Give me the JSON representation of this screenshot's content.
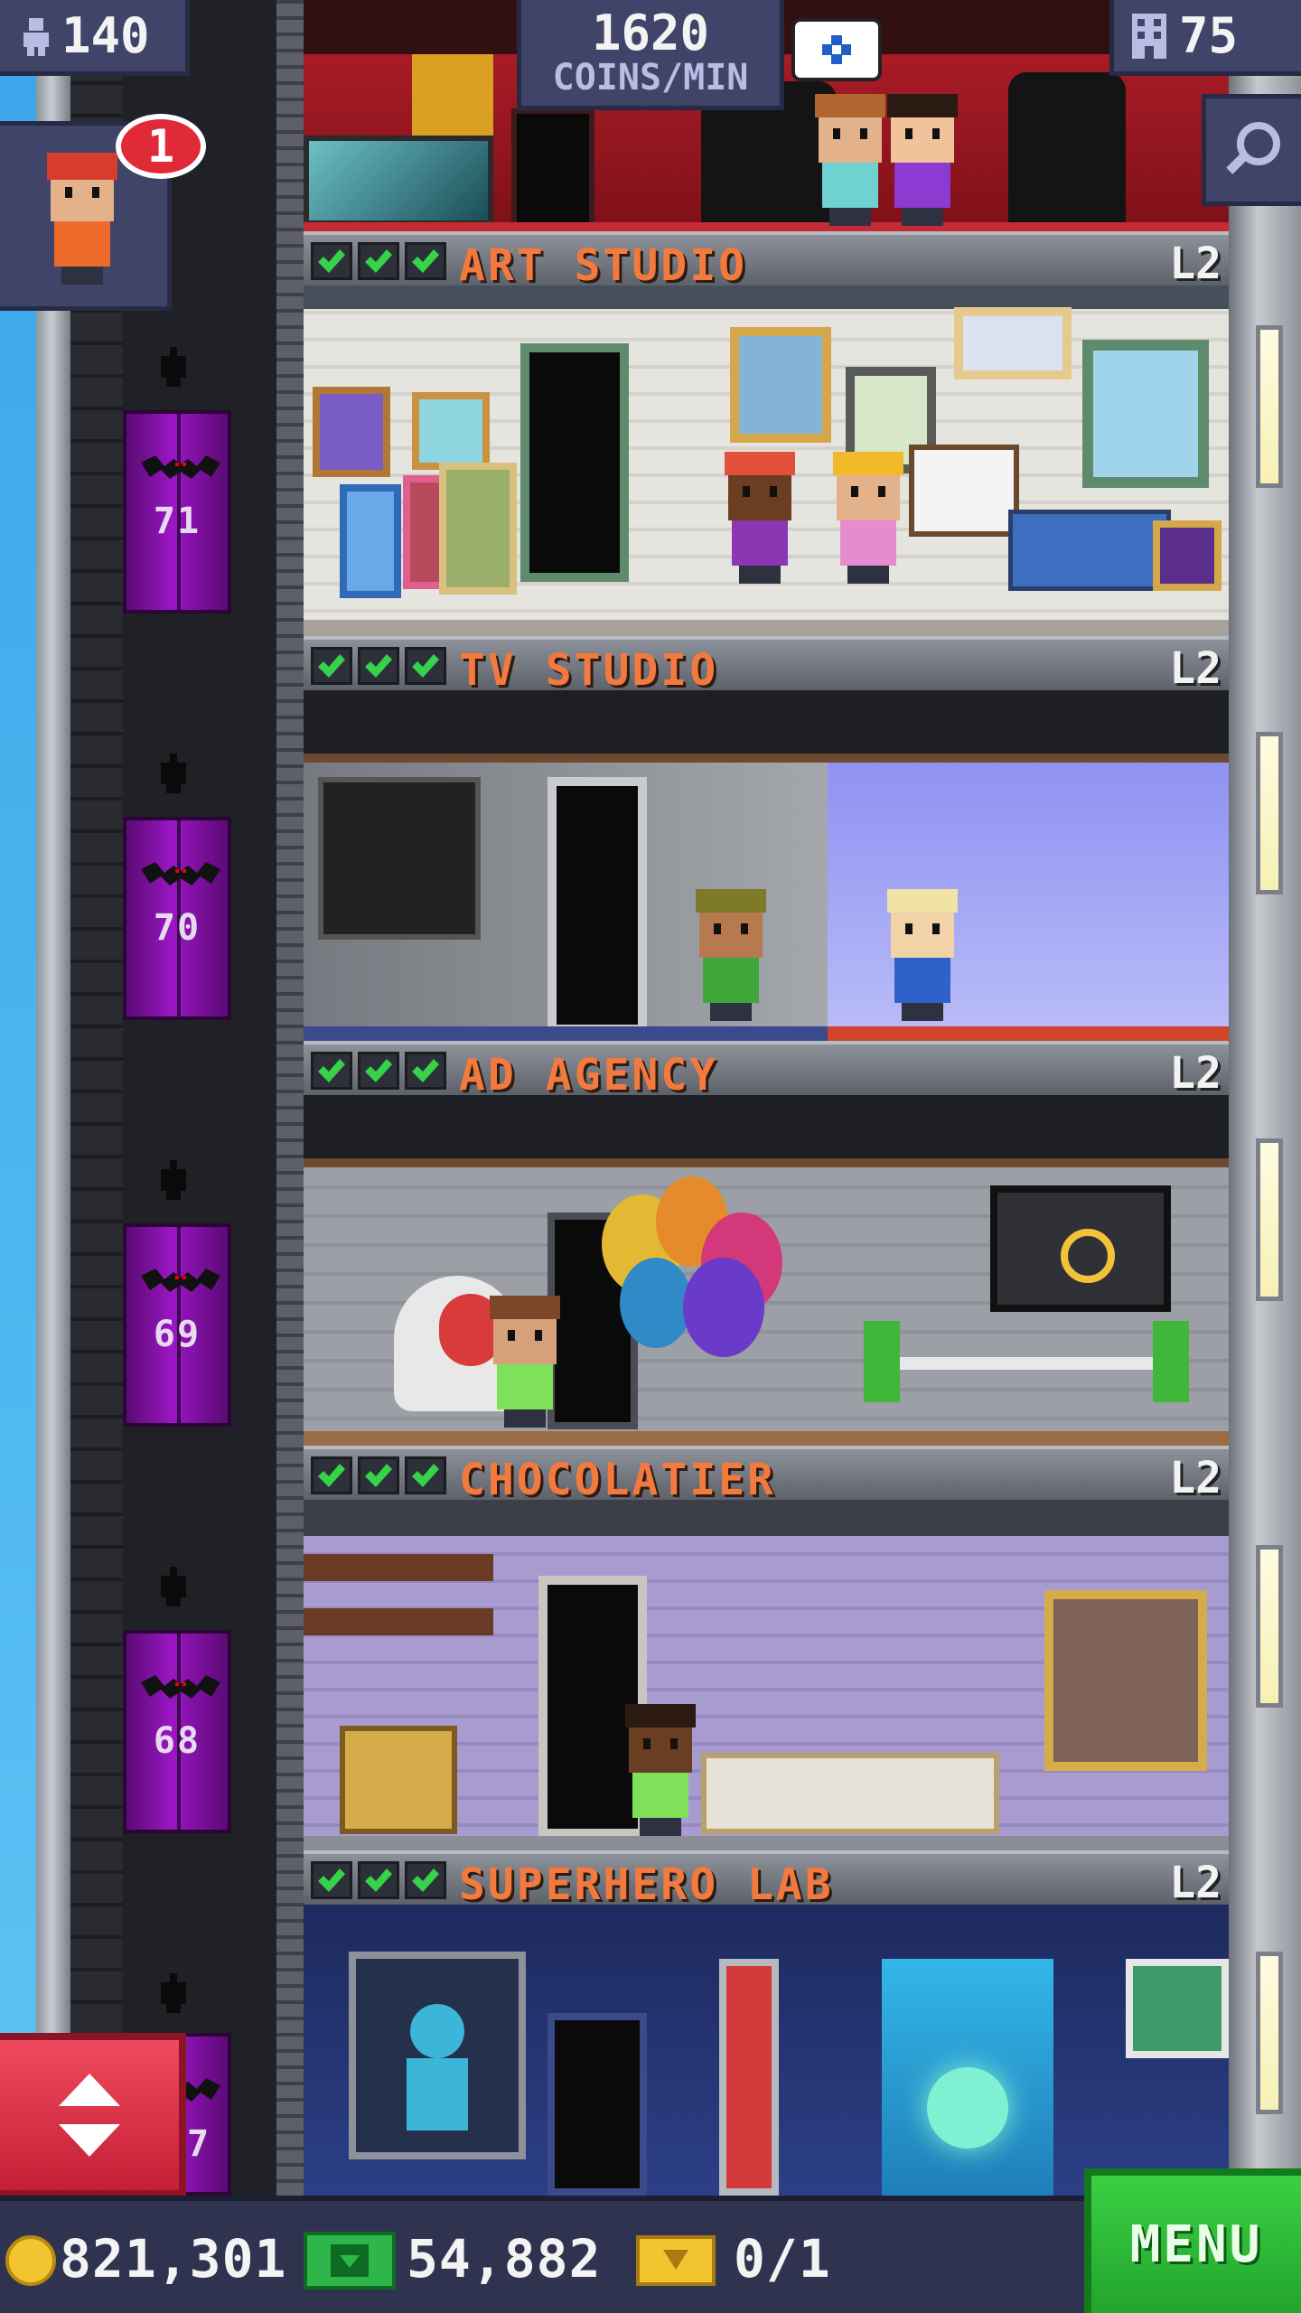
{
  "hud": {
    "population": "140",
    "income_amount": "1620",
    "income_unit": "COINS/MIN",
    "floors_count": "75",
    "notification_count": "1"
  },
  "elevator_floor_numbers": [
    "71",
    "70",
    "69",
    "68",
    "7"
  ],
  "floors": [
    {
      "name": "ART STUDIO",
      "level": "L2",
      "stock_checks": 3
    },
    {
      "name": "TV STUDIO",
      "level": "L2",
      "stock_checks": 3
    },
    {
      "name": "AD AGENCY",
      "level": "L2",
      "stock_checks": 3
    },
    {
      "name": "CHOCOLATIER",
      "level": "L2",
      "stock_checks": 3
    },
    {
      "name": "SUPERHERO LAB",
      "level": "L2",
      "stock_checks": 3
    }
  ],
  "currency": {
    "coins": "821,301",
    "bux": "54,882",
    "tickets": "0/1"
  },
  "menu_label": "MENU",
  "colors": {
    "floor_name": "#f37a3e",
    "check_green": "#35d24a",
    "menu_green": "#2fc23a",
    "elevator_button_red": "#e8304a",
    "elevator_purple": "#9b16c4"
  },
  "icons": {
    "population": "person-icon",
    "floors": "building-icon",
    "search": "magnifier-icon",
    "elevator": "up-down-arrows-icon",
    "coin": "coin-icon",
    "bux": "cash-icon",
    "ticket": "golden-ticket-icon"
  }
}
